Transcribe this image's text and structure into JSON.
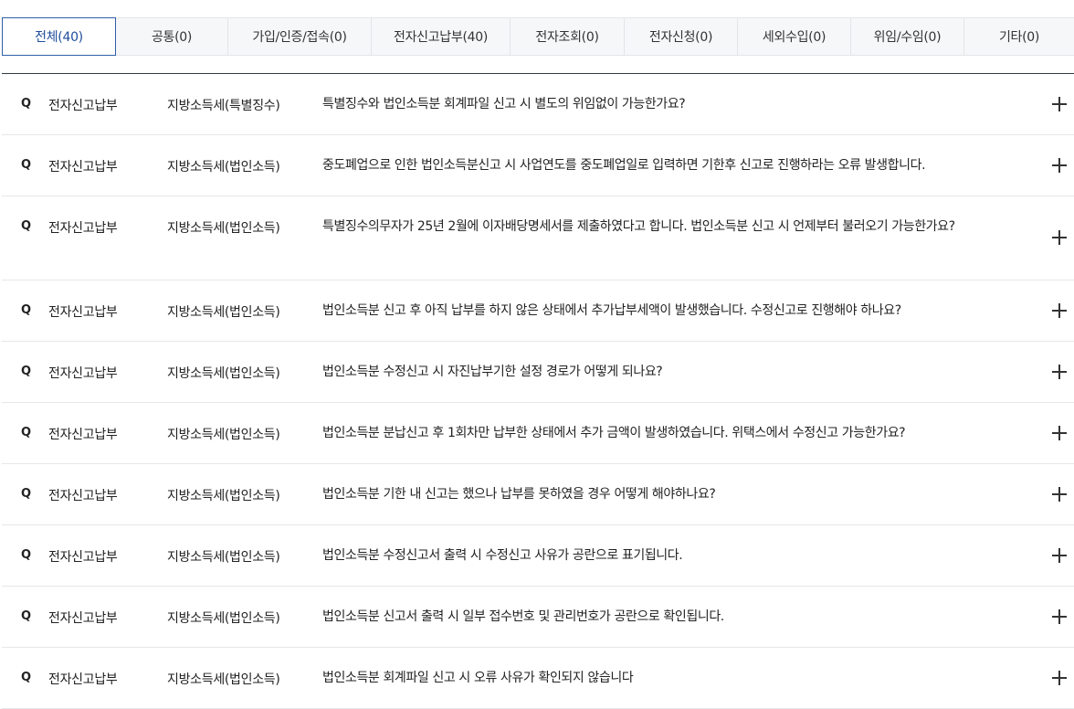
{
  "tabs": [
    {
      "label": "전체(40)",
      "active": true
    },
    {
      "label": "공통(0)",
      "active": false
    },
    {
      "label": "가입/인증/접속(0)",
      "active": false
    },
    {
      "label": "전자신고납부(40)",
      "active": false
    },
    {
      "label": "전자조회(0)",
      "active": false
    },
    {
      "label": "전자신청(0)",
      "active": false
    },
    {
      "label": "세외수입(0)",
      "active": false
    },
    {
      "label": "위임/수임(0)",
      "active": false
    },
    {
      "label": "기타(0)",
      "active": false
    }
  ],
  "faq": {
    "marker": "Q",
    "expand_icon": "plus-icon",
    "items": [
      {
        "category": "전자신고납부",
        "subcategory": "지방소득세(특별징수)",
        "question": "특별징수와 법인소득분 회계파일 신고 시 별도의 위임없이 가능한가요?"
      },
      {
        "category": "전자신고납부",
        "subcategory": "지방소득세(법인소득)",
        "question": "중도폐업으로 인한 법인소득분신고 시 사업연도를 중도폐업일로 입력하면 기한후 신고로 진행하라는 오류 발생합니다."
      },
      {
        "category": "전자신고납부",
        "subcategory": "지방소득세(법인소득)",
        "question": "특별징수의무자가 25년 2월에 이자배당명세서를 제출하였다고 합니다. 법인소득분 신고 시 언제부터 불러오기 가능한가요?"
      },
      {
        "category": "전자신고납부",
        "subcategory": "지방소득세(법인소득)",
        "question": "법인소득분 신고 후 아직 납부를 하지 않은 상태에서 추가납부세액이 발생했습니다. 수정신고로 진행해야 하나요?"
      },
      {
        "category": "전자신고납부",
        "subcategory": "지방소득세(법인소득)",
        "question": "법인소득분 수정신고 시 자진납부기한 설정 경로가 어떻게 되나요?"
      },
      {
        "category": "전자신고납부",
        "subcategory": "지방소득세(법인소득)",
        "question": "법인소득분 분납신고 후 1회차만 납부한 상태에서 추가 금액이 발생하였습니다. 위택스에서 수정신고 가능한가요?"
      },
      {
        "category": "전자신고납부",
        "subcategory": "지방소득세(법인소득)",
        "question": "법인소득분 기한 내 신고는 했으나 납부를 못하였을 경우 어떻게 해야하나요?"
      },
      {
        "category": "전자신고납부",
        "subcategory": "지방소득세(법인소득)",
        "question": "법인소득분 수정신고서 출력 시 수정신고 사유가 공란으로 표기됩니다."
      },
      {
        "category": "전자신고납부",
        "subcategory": "지방소득세(법인소득)",
        "question": "법인소득분 신고서 출력 시 일부 접수번호 및 관리번호가 공란으로 확인됩니다."
      },
      {
        "category": "전자신고납부",
        "subcategory": "지방소득세(법인소득)",
        "question": "법인소득분 회계파일 신고 시 오류 사유가 확인되지 않습니다"
      }
    ]
  }
}
